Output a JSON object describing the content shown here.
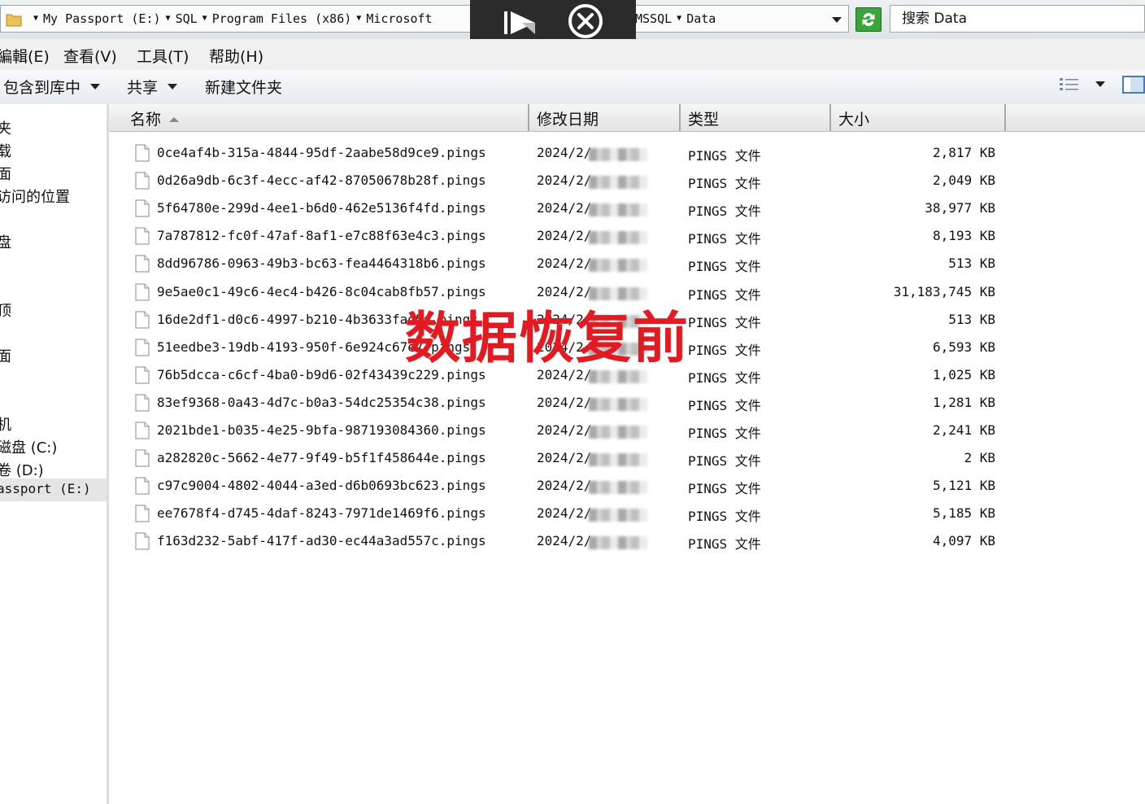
{
  "address_bar": {
    "crumbs": [
      "My Passport (E:)",
      "SQL",
      "Program Files (x86)",
      "Microsoft"
    ],
    "crumbs_after_overlay": [
      "MSSQL",
      "Data"
    ],
    "search_placeholder": "搜索 Data"
  },
  "menu": {
    "items": [
      "編輯(E)",
      "查看(V)",
      "工具(T)",
      "帮助(H)"
    ]
  },
  "toolbar": {
    "include_in_library": "包含到库中",
    "share": "共享",
    "new_folder": "新建文件夹"
  },
  "nav": {
    "items": [
      "夹",
      "载",
      "面",
      "访问的位置",
      "",
      "盘",
      "",
      "",
      "顶",
      "",
      "面",
      "",
      "",
      "",
      "机",
      "磁盘 (C:)",
      "卷 (D:)",
      "assport (E:)"
    ],
    "selected_label": "assport (E:)"
  },
  "columns": {
    "name": "名称",
    "date": "修改日期",
    "type": "类型",
    "size": "大小"
  },
  "files": [
    {
      "name": "0ce4af4b-315a-4844-95df-2aabe58d9ce9.pings",
      "date": "2024/2/",
      "type": "PINGS 文件",
      "size": "2,817 KB"
    },
    {
      "name": "0d26a9db-6c3f-4ecc-af42-87050678b28f.pings",
      "date": "2024/2/",
      "type": "PINGS 文件",
      "size": "2,049 KB"
    },
    {
      "name": "5f64780e-299d-4ee1-b6d0-462e5136f4fd.pings",
      "date": "2024/2/",
      "type": "PINGS 文件",
      "size": "38,977 KB"
    },
    {
      "name": "7a787812-fc0f-47af-8af1-e7c88f63e4c3.pings",
      "date": "2024/2/",
      "type": "PINGS 文件",
      "size": "8,193 KB"
    },
    {
      "name": "8dd96786-0963-49b3-bc63-fea4464318b6.pings",
      "date": "2024/2/",
      "type": "PINGS 文件",
      "size": "513 KB"
    },
    {
      "name": "9e5ae0c1-49c6-4ec4-b426-8c04cab8fb57.pings",
      "date": "2024/2/",
      "type": "PINGS 文件",
      "size": "31,183,745 KB"
    },
    {
      "name": "16de2df1-d0c6-4997-b210-4b3633fad5a.pings",
      "date": "2024/2/",
      "type": "PINGS 文件",
      "size": "513 KB"
    },
    {
      "name": "51eedbe3-19db-4193-950f-6e924c67e7.pings",
      "date": "2024/2/",
      "type": "PINGS 文件",
      "size": "6,593 KB"
    },
    {
      "name": "76b5dcca-c6cf-4ba0-b9d6-02f43439c229.pings",
      "date": "2024/2/",
      "type": "PINGS 文件",
      "size": "1,025 KB"
    },
    {
      "name": "83ef9368-0a43-4d7c-b0a3-54dc25354c38.pings",
      "date": "2024/2/",
      "type": "PINGS 文件",
      "size": "1,281 KB"
    },
    {
      "name": "2021bde1-b035-4e25-9bfa-987193084360.pings",
      "date": "2024/2/",
      "type": "PINGS 文件",
      "size": "2,241 KB"
    },
    {
      "name": "a282820c-5662-4e77-9f49-b5f1f458644e.pings",
      "date": "2024/2/",
      "type": "PINGS 文件",
      "size": "2 KB"
    },
    {
      "name": "c97c9004-4802-4044-a3ed-d6b0693bc623.pings",
      "date": "2024/2/",
      "type": "PINGS 文件",
      "size": "5,121 KB"
    },
    {
      "name": "ee7678f4-d745-4daf-8243-7971de1469f6.pings",
      "date": "2024/2/",
      "type": "PINGS 文件",
      "size": "5,185 KB"
    },
    {
      "name": "f163d232-5abf-417f-ad30-ec44a3ad557c.pings",
      "date": "2024/2/",
      "type": "PINGS 文件",
      "size": "4,097 KB"
    }
  ],
  "overlay": {
    "watermark": "数据恢复前",
    "watermark_color": "#e21b23"
  },
  "icons": {
    "folder": "folder-icon",
    "refresh": "refresh-icon",
    "play": "play-icon",
    "close": "close-icon",
    "file": "file-icon",
    "view": "view-details-icon",
    "pane": "preview-pane-icon"
  }
}
